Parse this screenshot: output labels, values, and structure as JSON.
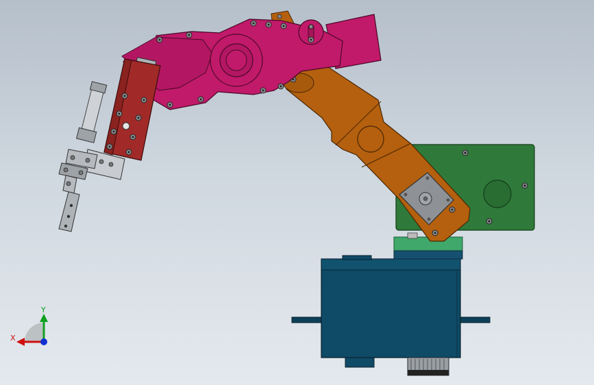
{
  "viewport": {
    "type": "cad-3d-viewport",
    "background_top": "#b5bfca",
    "background_bottom": "#e4e9ee"
  },
  "model": {
    "parts": [
      {
        "name": "base-servo-housing",
        "color": "#0f4a66"
      },
      {
        "name": "base-coupling-ring",
        "color": "#3fa86a"
      },
      {
        "name": "stepper-motor-mount-plate",
        "color": "#2f7a3a"
      },
      {
        "name": "lower-arm-link",
        "color": "#b4600e"
      },
      {
        "name": "upper-arm-link",
        "color": "#c11a6a"
      },
      {
        "name": "wrist-bracket",
        "color": "#a12a28"
      },
      {
        "name": "gripper-assembly",
        "color": "#9ea3a8"
      },
      {
        "name": "stepper-motor-face",
        "color": "#8e9196"
      }
    ]
  },
  "triad": {
    "x_label": "X",
    "y_label": "Y",
    "x_color": "#d01010",
    "y_color": "#0fa020",
    "z_color": "#1030d0"
  }
}
